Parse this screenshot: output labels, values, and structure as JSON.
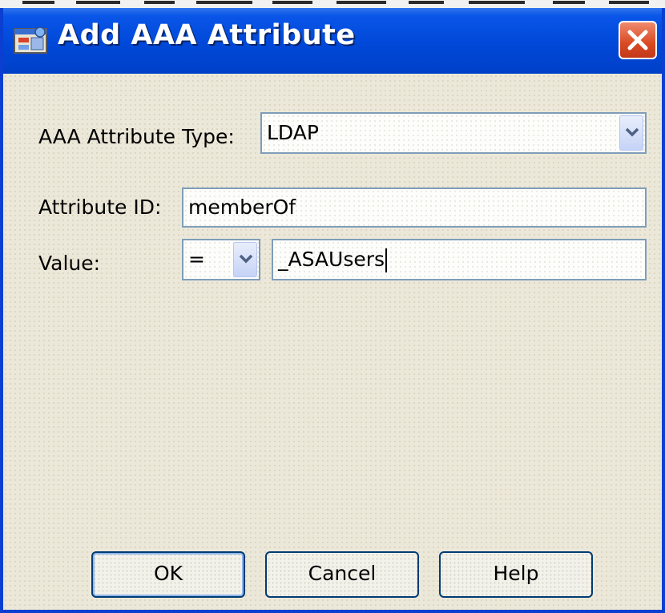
{
  "dialog": {
    "title": "Add AAA Attribute",
    "icon": "app-window-icon",
    "close_icon": "close-x-icon"
  },
  "form": {
    "type_label": "AAA Attribute Type:",
    "type_value": "LDAP",
    "id_label": "Attribute ID:",
    "id_value": "memberOf",
    "value_label": "Value:",
    "operator_value": "=",
    "value_text": "_ASAUsers"
  },
  "buttons": {
    "ok": "OK",
    "cancel": "Cancel",
    "help": "Help"
  },
  "colors": {
    "titlebar": "#0048d8",
    "client_bg": "#ece8d9",
    "close_button": "#d94a22"
  }
}
